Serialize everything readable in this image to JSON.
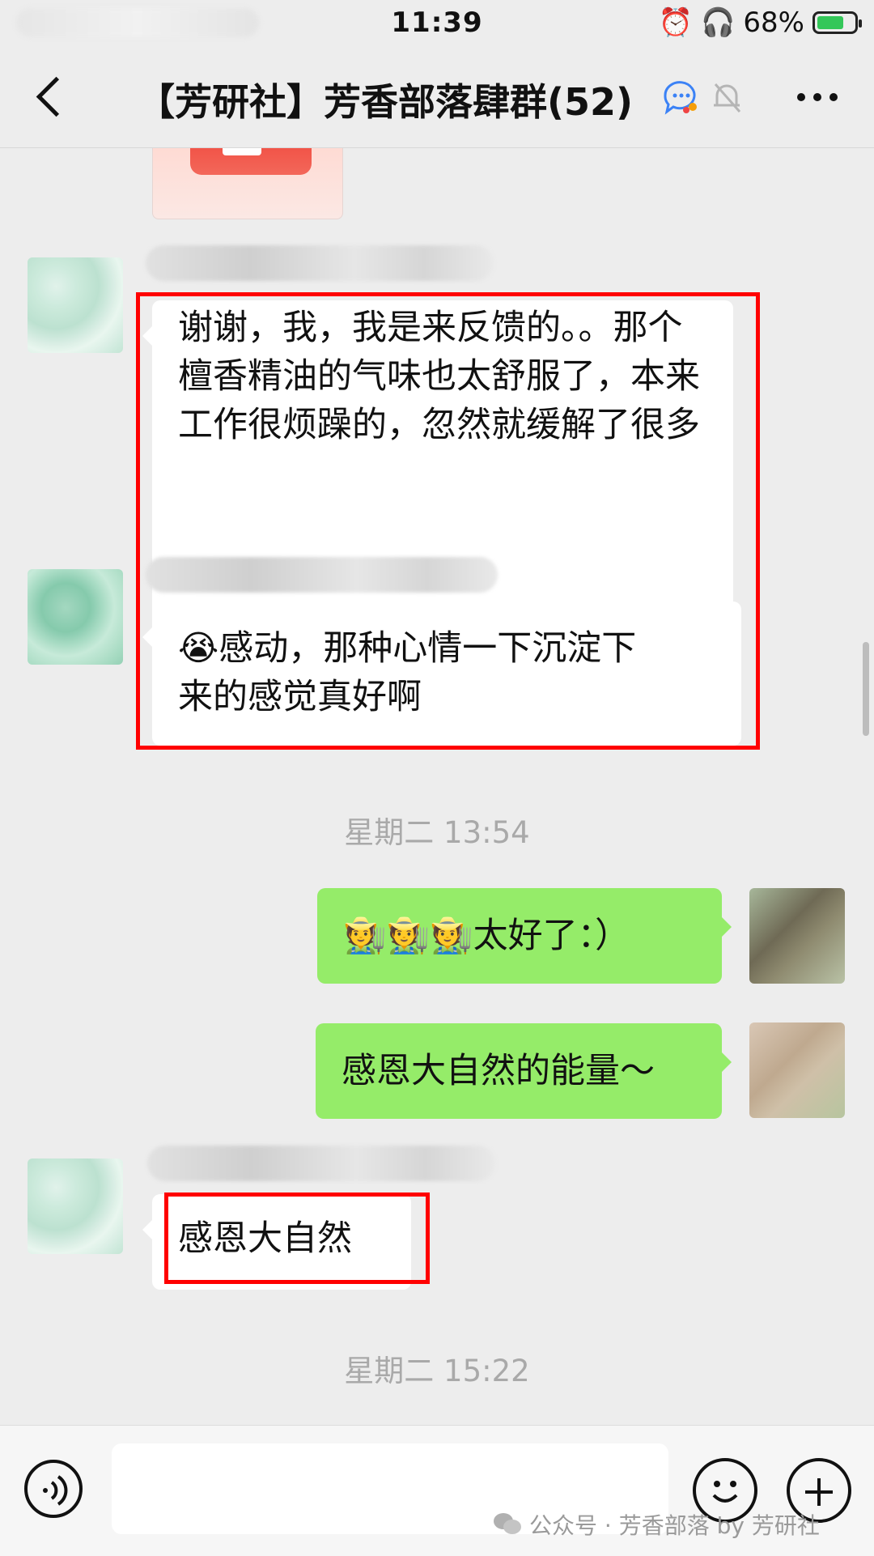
{
  "status_bar": {
    "time": "11:39",
    "battery": "68%"
  },
  "header": {
    "title": "【芳研社】芳香部落肆群(52)"
  },
  "messages": {
    "m1": "谢谢，我，我是来反馈的。。那个檀香精油的气味也太舒服了，本来工作很烦躁的，忽然就缓解了很多",
    "m2_line1": "😭感动，那种心情一下沉淀下",
    "m2_line2": "来的感觉真好啊",
    "time1": "星期二 13:54",
    "m3": "🧑‍🌾🧑‍🌾🧑‍🌾太好了：）",
    "m4": "感恩大自然的能量～",
    "m5": "感恩大自然",
    "time2": "星期二 15:22"
  },
  "watermark": "公众号 · 芳香部落 by 芳研社",
  "colors": {
    "my_bubble": "#95ec69",
    "highlight": "#ff0000",
    "background": "#ededed"
  },
  "icons": [
    "back-icon",
    "group-chat-icon",
    "mute-bell-icon",
    "more-icon",
    "voice-icon",
    "emoji-icon",
    "plus-icon",
    "wechat-logo-icon"
  ]
}
